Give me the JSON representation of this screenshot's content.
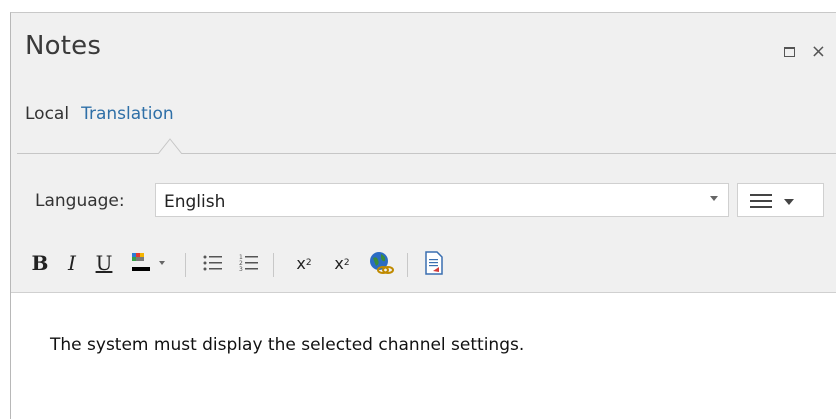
{
  "window": {
    "title": "Notes",
    "restore_icon": "restore-window-icon",
    "close_label": "×"
  },
  "tabs": [
    {
      "label": "Local",
      "active": false
    },
    {
      "label": "Translation",
      "active": true
    }
  ],
  "language": {
    "label": "Language:",
    "selected": "English"
  },
  "toolbar": {
    "bold": "B",
    "italic": "I",
    "underline": "U",
    "superscript": "x",
    "superscript_mark": "2",
    "subscript": "x",
    "subscript_mark": "2",
    "icons": [
      "text-color-icon",
      "bullet-list-icon",
      "numbered-list-icon",
      "superscript-icon",
      "subscript-icon",
      "hyperlink-icon",
      "linked-document-icon"
    ]
  },
  "editor": {
    "text": "The system must display the selected channel settings."
  },
  "colors": {
    "accent": "#2e6fa7",
    "panel_bg": "#f0f0f0"
  }
}
